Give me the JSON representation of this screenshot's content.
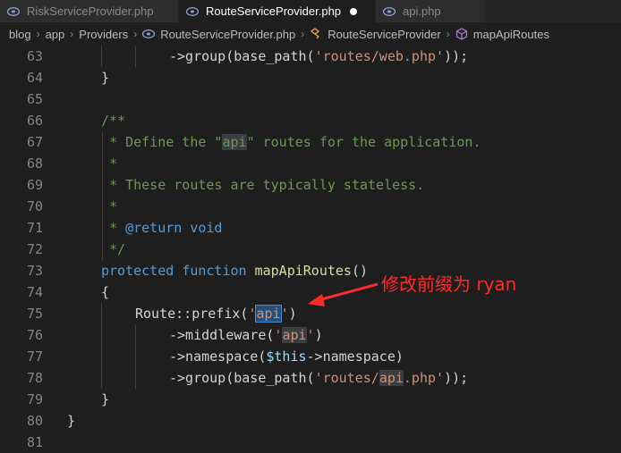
{
  "tabs": [
    {
      "label": "RiskServiceProvider.php",
      "icon": "php-file-icon",
      "active": false
    },
    {
      "label": "RouteServiceProvider.php",
      "icon": "php-file-icon",
      "active": true,
      "modified": true
    },
    {
      "label": "api.php",
      "icon": "php-file-icon",
      "active": false
    }
  ],
  "breadcrumb": {
    "items": [
      "blog",
      "app",
      "Providers",
      "RouteServiceProvider.php",
      "RouteServiceProvider",
      "mapApiRoutes"
    ]
  },
  "code": {
    "lines": [
      {
        "n": "63",
        "indent": 3,
        "tokens": [
          {
            "t": "->group(base_path(",
            "c": "plain"
          },
          {
            "t": "'routes/web.php'",
            "c": "str"
          },
          {
            "t": "));",
            "c": "plain"
          }
        ]
      },
      {
        "n": "64",
        "indent": 1,
        "tokens": [
          {
            "t": "}",
            "c": "plain"
          }
        ]
      },
      {
        "n": "65",
        "indent": 0,
        "tokens": []
      },
      {
        "n": "66",
        "indent": 1,
        "tokens": [
          {
            "t": "/**",
            "c": "cmt"
          }
        ]
      },
      {
        "n": "67",
        "indent": 1,
        "tokens": [
          {
            "t": " * Define the \"",
            "c": "cmt"
          },
          {
            "t": "api",
            "c": "cmt-hl"
          },
          {
            "t": "\" routes for the application.",
            "c": "cmt"
          }
        ]
      },
      {
        "n": "68",
        "indent": 1,
        "tokens": [
          {
            "t": " *",
            "c": "cmt"
          }
        ]
      },
      {
        "n": "69",
        "indent": 1,
        "tokens": [
          {
            "t": " * These routes are typically stateless.",
            "c": "cmt"
          }
        ]
      },
      {
        "n": "70",
        "indent": 1,
        "tokens": [
          {
            "t": " *",
            "c": "cmt"
          }
        ]
      },
      {
        "n": "71",
        "indent": 1,
        "tokens": [
          {
            "t": " * ",
            "c": "cmt"
          },
          {
            "t": "@return",
            "c": "kw"
          },
          {
            "t": " void",
            "c": "kw"
          }
        ]
      },
      {
        "n": "72",
        "indent": 1,
        "tokens": [
          {
            "t": " */",
            "c": "cmt"
          }
        ]
      },
      {
        "n": "73",
        "indent": 1,
        "tokens": [
          {
            "t": "protected",
            "c": "kw"
          },
          {
            "t": " ",
            "c": "plain"
          },
          {
            "t": "function",
            "c": "kw"
          },
          {
            "t": " ",
            "c": "plain"
          },
          {
            "t": "mapApiRoutes",
            "c": "fn"
          },
          {
            "t": "()",
            "c": "plain"
          }
        ]
      },
      {
        "n": "74",
        "indent": 1,
        "tokens": [
          {
            "t": "{",
            "c": "plain"
          }
        ]
      },
      {
        "n": "75",
        "indent": 2,
        "tokens": [
          {
            "t": "Route::prefix(",
            "c": "plain"
          },
          {
            "t": "'",
            "c": "str"
          },
          {
            "t": "api",
            "c": "str-sel"
          },
          {
            "t": "'",
            "c": "str"
          },
          {
            "t": ")",
            "c": "plain"
          }
        ]
      },
      {
        "n": "76",
        "indent": 3,
        "tokens": [
          {
            "t": "->middleware(",
            "c": "plain"
          },
          {
            "t": "'",
            "c": "str"
          },
          {
            "t": "api",
            "c": "str-hl"
          },
          {
            "t": "'",
            "c": "str"
          },
          {
            "t": ")",
            "c": "plain"
          }
        ]
      },
      {
        "n": "77",
        "indent": 3,
        "tokens": [
          {
            "t": "->namespace(",
            "c": "plain"
          },
          {
            "t": "$this",
            "c": "var"
          },
          {
            "t": "->namespace)",
            "c": "plain"
          }
        ]
      },
      {
        "n": "78",
        "indent": 3,
        "tokens": [
          {
            "t": "->group(base_path(",
            "c": "plain"
          },
          {
            "t": "'routes/",
            "c": "str"
          },
          {
            "t": "api",
            "c": "str-hl"
          },
          {
            "t": ".php'",
            "c": "str"
          },
          {
            "t": "));",
            "c": "plain"
          }
        ]
      },
      {
        "n": "79",
        "indent": 1,
        "tokens": [
          {
            "t": "}",
            "c": "plain"
          }
        ]
      },
      {
        "n": "80",
        "indent": 0,
        "tokens": [
          {
            "t": "}",
            "c": "plain"
          }
        ]
      },
      {
        "n": "81",
        "indent": 0,
        "tokens": []
      }
    ]
  },
  "annotation": {
    "text": "修改前缀为 ryan",
    "color": "#ff2b2b"
  },
  "colors": {
    "background": "#1e1e1e",
    "keyword": "#569cd6",
    "string": "#ce9178",
    "comment": "#6a9955",
    "function": "#dcdcaa"
  }
}
